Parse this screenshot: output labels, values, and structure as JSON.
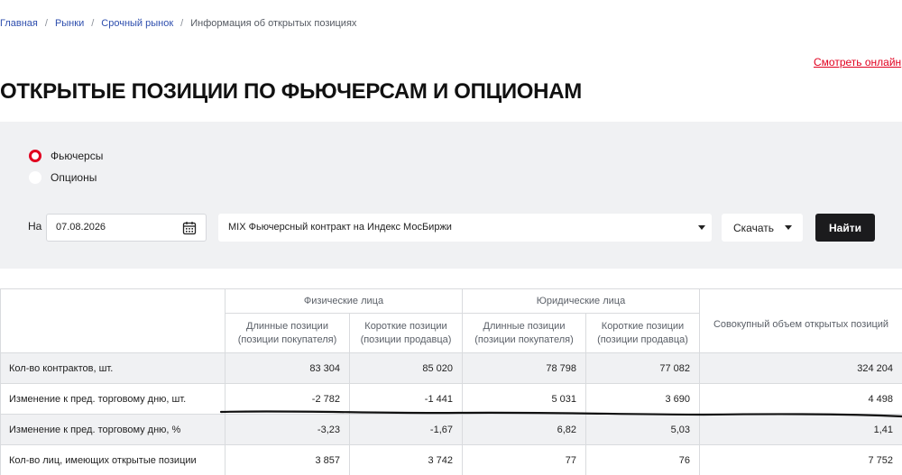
{
  "breadcrumb": {
    "items": [
      "Главная",
      "Рынки",
      "Срочный рынок"
    ],
    "current": "Информация об открытых позициях"
  },
  "header": {
    "watch_online": "Смотреть онлайн",
    "title": "ОТКРЫТЫЕ ПОЗИЦИИ ПО ФЬЮЧЕРСАМ И ОПЦИОНАМ"
  },
  "filters": {
    "instrument_type": {
      "options": [
        "Фьючерсы",
        "Опционы"
      ],
      "selected": "Фьючерсы"
    },
    "date_label": "На",
    "date_value": "07.08.2026",
    "instrument": "MIX Фьючерсный контракт на Индекс МосБиржи",
    "download_label": "Скачать",
    "find_label": "Найти"
  },
  "table": {
    "group_headers": [
      "Физические лица",
      "Юридические лица",
      "Совокупный объем открытых позиций"
    ],
    "sub_headers": [
      "Длинные позиции (позиции покупателя)",
      "Короткие позиции (позиции продавца)",
      "Длинные позиции (позиции покупателя)",
      "Короткие позиции (позиции продавца)"
    ],
    "rows": [
      {
        "label": "Кол-во контрактов, шт.",
        "values": [
          "83 304",
          "85 020",
          "78 798",
          "77 082",
          "324 204"
        ]
      },
      {
        "label": "Изменение к пред. торговому дню, шт.",
        "values": [
          "-2 782",
          "-1 441",
          "5 031",
          "3 690",
          "4 498"
        ]
      },
      {
        "label": "Изменение к пред. торговому дню, %",
        "values": [
          "-3,23",
          "-1,67",
          "6,82",
          "5,03",
          "1,41"
        ]
      },
      {
        "label": "Кол-во лиц, имеющих открытые позиции",
        "values": [
          "3 857",
          "3 742",
          "77",
          "76",
          "7 752"
        ]
      }
    ]
  },
  "colors": {
    "accent_red": "#e1001f",
    "link_blue": "#2f4fae",
    "panel_gray": "#f0f1f3",
    "button_dark": "#1b1b1d"
  },
  "icons": [
    "calendar-icon",
    "chevron-down-icon",
    "radio-checked-icon"
  ]
}
